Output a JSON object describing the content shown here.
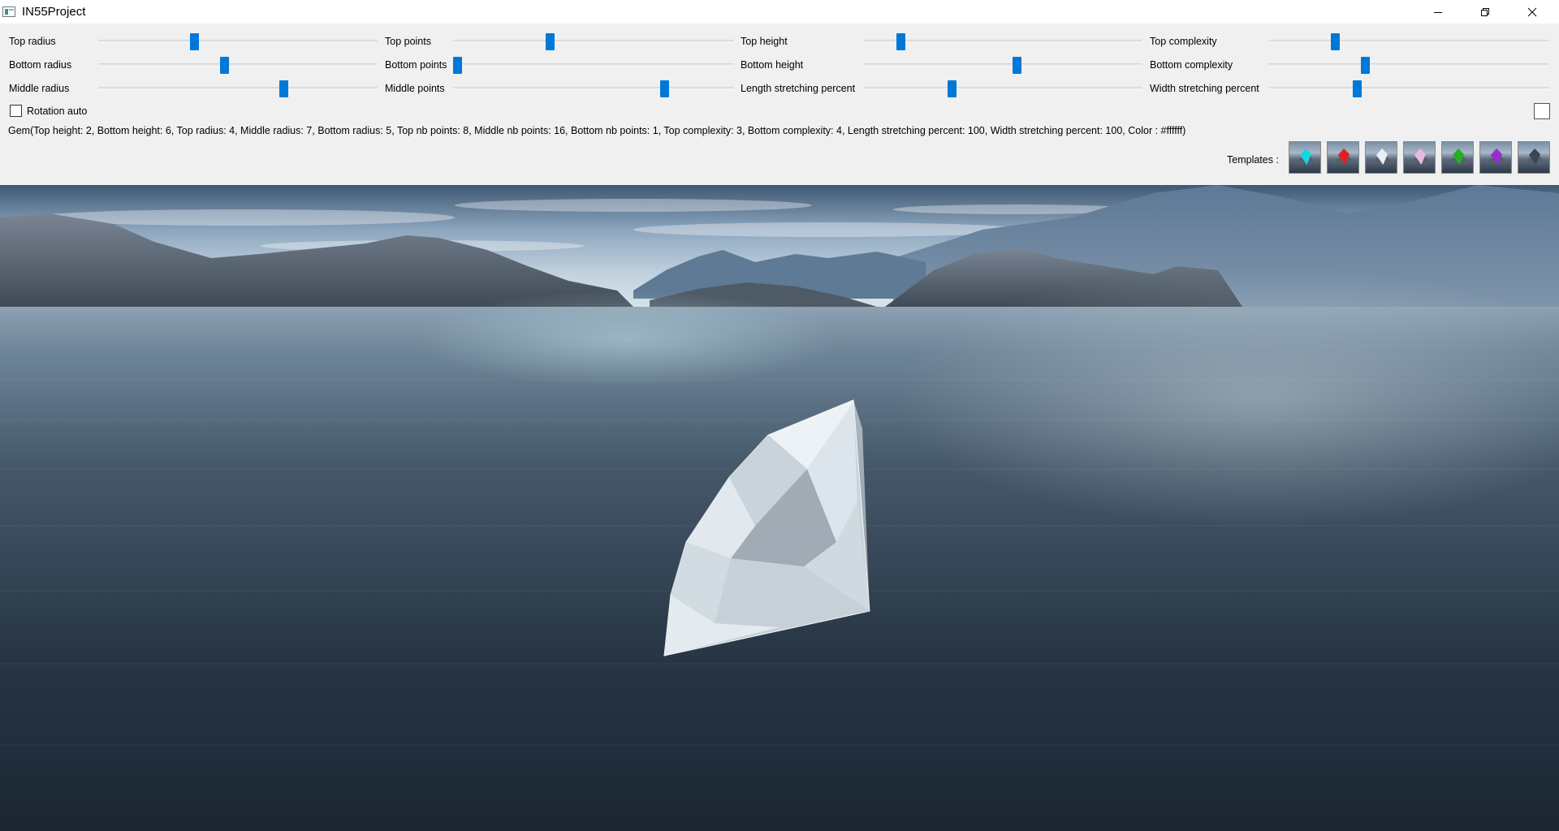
{
  "window": {
    "title": "IN55Project"
  },
  "sliders": [
    {
      "label": "Top radius",
      "value": 0.34
    },
    {
      "label": "Top points",
      "value": 0.34
    },
    {
      "label": "Top height",
      "value": 0.12
    },
    {
      "label": "Top complexity",
      "value": 0.23
    },
    {
      "label": "Bottom radius",
      "value": 0.45
    },
    {
      "label": "Bottom points",
      "value": 0.0
    },
    {
      "label": "Bottom height",
      "value": 0.55
    },
    {
      "label": "Bottom complexity",
      "value": 0.34
    },
    {
      "label": "Middle radius",
      "value": 0.67
    },
    {
      "label": "Middle points",
      "value": 0.76
    },
    {
      "label": "Length stretching percent",
      "value": 0.31
    },
    {
      "label": "Width stretching percent",
      "value": 0.31
    }
  ],
  "rotation": {
    "label": "Rotation auto",
    "checked": false
  },
  "color_swatch": "#ffffff",
  "gem_info": "Gem(Top height: 2, Bottom height: 6, Top radius: 4, Middle radius: 7, Bottom radius: 5, Top nb points: 8, Middle nb points: 16, Bottom nb points: 1, Top complexity: 3, Bottom complexity: 4, Length stretching percent: 100, Width stretching percent: 100, Color : #ffffff)",
  "templates": {
    "label": "Templates :",
    "items": [
      {
        "name": "template-cyan-gem",
        "color": "#19d3e0"
      },
      {
        "name": "template-red-gem",
        "color": "#e02020"
      },
      {
        "name": "template-white-gem",
        "color": "#e8eef2"
      },
      {
        "name": "template-pink-gem",
        "color": "#e8b8e0"
      },
      {
        "name": "template-green-gem",
        "color": "#22b022"
      },
      {
        "name": "template-purple-gem",
        "color": "#9a2ad0"
      },
      {
        "name": "template-dark-gem",
        "color": "#3a4654"
      }
    ]
  }
}
